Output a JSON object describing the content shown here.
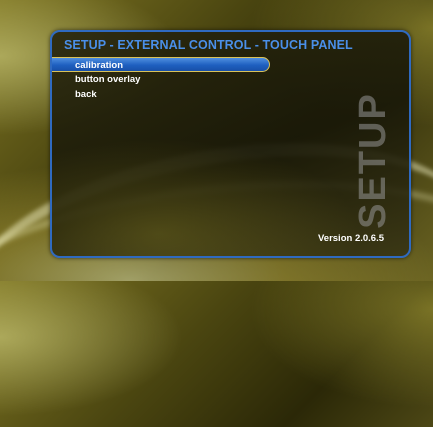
{
  "screen": {
    "title": "SETUP - EXTERNAL CONTROL - TOUCH PANEL",
    "watermark": "SETUP",
    "version": "Version 2.0.6.5"
  },
  "menu": {
    "items": [
      {
        "label": "calibration",
        "selected": true
      },
      {
        "label": "button overlay",
        "selected": false
      },
      {
        "label": "back",
        "selected": false
      }
    ]
  },
  "colors": {
    "title": "#4a8fe8",
    "highlight": "#2a6fd0",
    "highlight_border": "#d9c25a",
    "panel_border": "#2f6ac0"
  }
}
